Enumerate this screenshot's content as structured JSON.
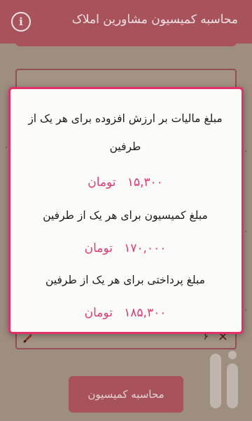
{
  "app_bar": {
    "title": "محاسبه کمیسیون مشاورین املاک",
    "info_icon": "info-icon",
    "background_color": "#a8525b"
  },
  "background_form": {
    "field_value": "۶",
    "calculate_button_label": "محاسبه کمیسیون"
  },
  "dialog": {
    "border_color": "#e4306a",
    "value_color": "#e53770",
    "rows": [
      {
        "label": "مبلغ مالیات بر ارزش افزوده برای هر یک از طرفین",
        "amount": "۱۵,۳۰۰",
        "unit": "تومان"
      },
      {
        "label": "مبلغ کمیسیون برای هر یک از طرفین",
        "amount": "۱۷۰,۰۰۰",
        "unit": "تومان"
      },
      {
        "label": "مبلغ پرداختی برای هر یک از طرفین",
        "amount": "۱۸۵,۳۰۰",
        "unit": "تومان"
      }
    ]
  }
}
